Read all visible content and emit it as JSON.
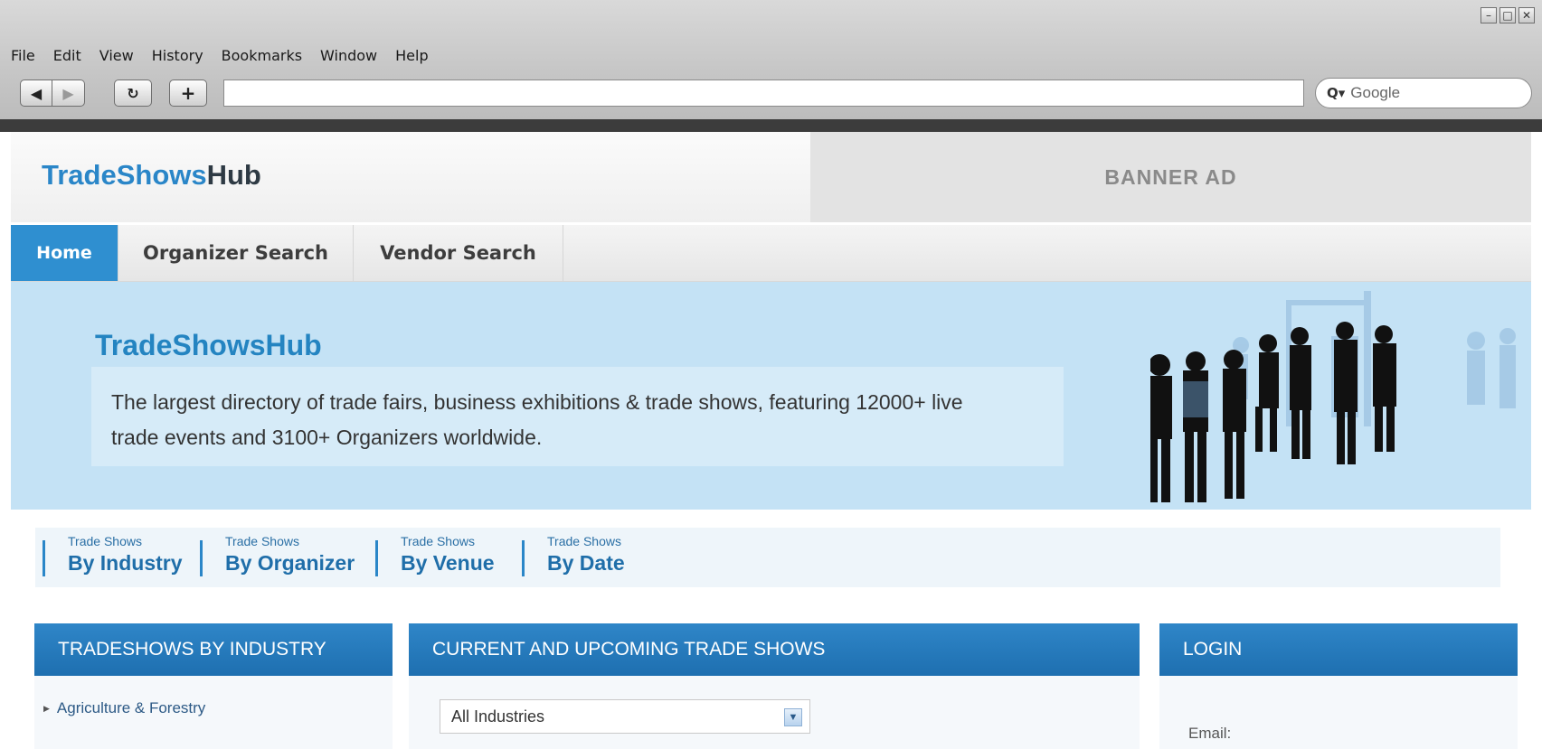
{
  "browser": {
    "menu": [
      "File",
      "Edit",
      "View",
      "History",
      "Bookmarks",
      "Window",
      "Help"
    ],
    "nav_icons": {
      "back": "back-arrow-icon",
      "forward": "forward-arrow-icon",
      "reload": "reload-icon",
      "new_tab": "plus-icon"
    },
    "url": "",
    "search_placeholder": "Google",
    "window_controls": [
      "minimize-icon",
      "maximize-icon",
      "close-icon"
    ]
  },
  "site": {
    "logo_part1": "TradeShows",
    "logo_part2": "Hub",
    "banner": "BANNER AD",
    "nav": [
      "Home",
      "Organizer Search",
      "Vendor Search"
    ],
    "hero": {
      "title": "TradeShowsHub",
      "text": "The largest directory of trade fairs, business exhibitions & trade shows, featuring 12000+ live trade events and 3100+ Organizers worldwide."
    },
    "by_tabs": [
      {
        "small": "Trade Shows",
        "big": "By Industry"
      },
      {
        "small": "Trade Shows",
        "big": "By Organizer"
      },
      {
        "small": "Trade Shows",
        "big": "By Venue"
      },
      {
        "small": "Trade Shows",
        "big": "By Date"
      }
    ],
    "panels": {
      "industry_title": "TRADESHOWS BY INDUSTRY",
      "industries": [
        "Agriculture & Forestry"
      ],
      "current_title": "CURRENT AND UPCOMING TRADE SHOWS",
      "industry_select_value": "All Industries",
      "login_title": "LOGIN",
      "email_label": "Email:"
    }
  },
  "colors": {
    "accent": "#2a86c8",
    "panel_header": "#1e6fb0",
    "hero_bg": "#c4e2f5"
  }
}
